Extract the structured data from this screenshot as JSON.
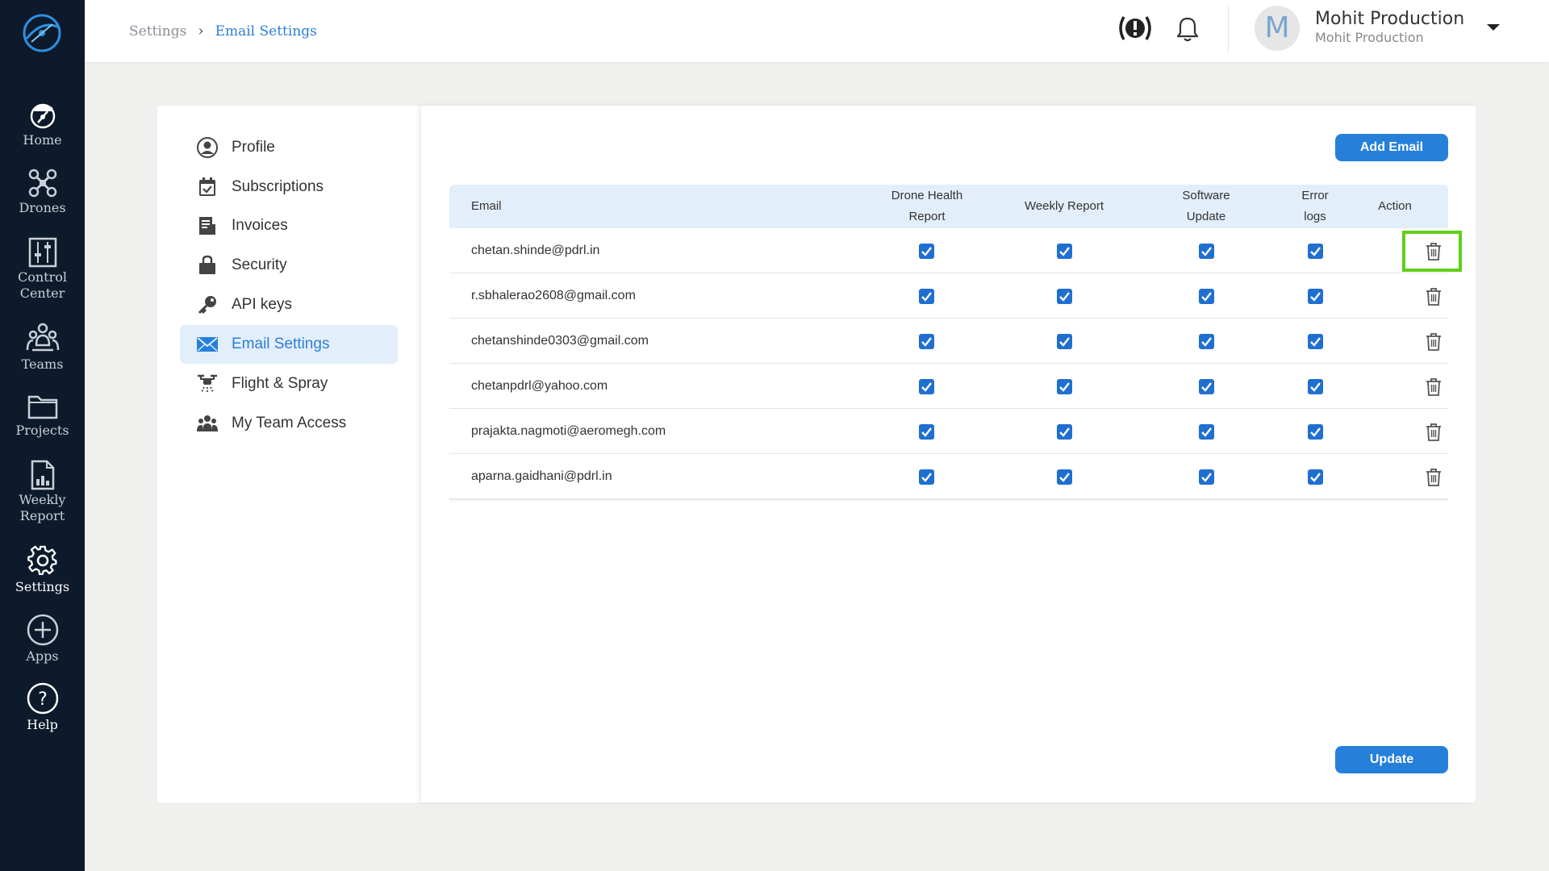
{
  "rail": {
    "items": [
      {
        "label": "Home",
        "icon": "home-drone-icon"
      },
      {
        "label": "Drones",
        "icon": "drone-icon"
      },
      {
        "label": "Control\nCenter",
        "label_line1": "Control",
        "label_line2": "Center",
        "icon": "sliders-icon"
      },
      {
        "label": "Teams",
        "icon": "teams-icon"
      },
      {
        "label": "Projects",
        "icon": "folder-icon"
      },
      {
        "label_line1": "Weekly",
        "label_line2": "Report",
        "icon": "report-icon"
      },
      {
        "label": "Settings",
        "icon": "gear-icon",
        "active": true
      },
      {
        "label": "Apps",
        "icon": "plus-circle-icon"
      },
      {
        "label": "Help",
        "icon": "help-circle-icon"
      }
    ]
  },
  "header": {
    "breadcrumb": {
      "parent": "Settings",
      "separator": "›",
      "current": "Email Settings"
    },
    "user": {
      "initial": "M",
      "name": "Mohit Production",
      "org": "Mohit Production"
    }
  },
  "menu": {
    "items": [
      {
        "label": "Profile",
        "icon": "user-circle-icon"
      },
      {
        "label": "Subscriptions",
        "icon": "calendar-check-icon"
      },
      {
        "label": "Invoices",
        "icon": "invoice-icon"
      },
      {
        "label": "Security",
        "icon": "lock-bag-icon"
      },
      {
        "label": "API keys",
        "icon": "key-icon"
      },
      {
        "label": "Email Settings",
        "icon": "envelope-icon",
        "active": true
      },
      {
        "label": "Flight & Spray",
        "icon": "spray-drone-icon"
      },
      {
        "label": "My Team Access",
        "icon": "team-icon"
      }
    ]
  },
  "content": {
    "add_button": "Add Email",
    "update_button": "Update",
    "table": {
      "headers": {
        "email": "Email",
        "drone_health_1": "Drone Health",
        "drone_health_2": "Report",
        "weekly": "Weekly Report",
        "software_1": "Software",
        "software_2": "Update",
        "error_1": "Error",
        "error_2": "logs",
        "action": "Action"
      },
      "rows": [
        {
          "email": "chetan.shinde@pdrl.in",
          "drone_health": true,
          "weekly": true,
          "software": true,
          "error_logs": true
        },
        {
          "email": "r.sbhalerao2608@gmail.com",
          "drone_health": true,
          "weekly": true,
          "software": true,
          "error_logs": true
        },
        {
          "email": "chetanshinde0303@gmail.com",
          "drone_health": true,
          "weekly": true,
          "software": true,
          "error_logs": true
        },
        {
          "email": "chetanpdrl@yahoo.com",
          "drone_health": true,
          "weekly": true,
          "software": true,
          "error_logs": true
        },
        {
          "email": "prajakta.nagmoti@aeromegh.com",
          "drone_health": true,
          "weekly": true,
          "software": true,
          "error_logs": true
        },
        {
          "email": "aparna.gaidhani@pdrl.in",
          "drone_health": true,
          "weekly": true,
          "software": true,
          "error_logs": true
        }
      ]
    }
  },
  "colors": {
    "rail_bg": "#0c1a2b",
    "accent": "#2680d9",
    "highlight": "#5fd017",
    "active_bg": "#e3eefb"
  }
}
